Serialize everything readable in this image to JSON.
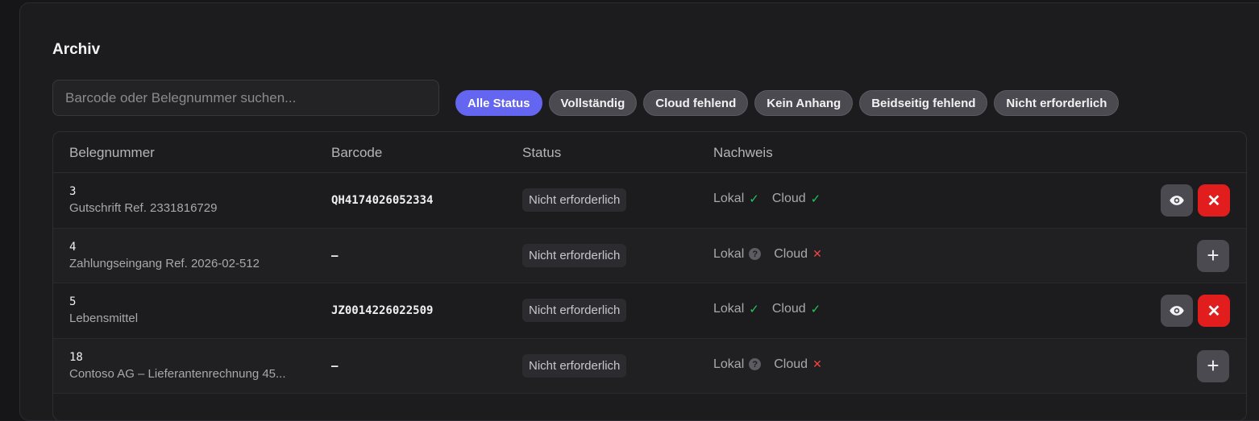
{
  "page": {
    "title": "Archiv"
  },
  "search": {
    "placeholder": "Barcode oder Belegnummer suchen..."
  },
  "filters": [
    "Alle Status",
    "Vollständig",
    "Cloud fehlend",
    "Kein Anhang",
    "Beidseitig fehlend",
    "Nicht erforderlich"
  ],
  "table": {
    "headers": {
      "number": "Belegnummer",
      "barcode": "Barcode",
      "status": "Status",
      "proof": "Nachweis"
    },
    "proof_labels": {
      "local": "Lokal",
      "cloud": "Cloud"
    },
    "rows": [
      {
        "number": "3",
        "subtitle": "Gutschrift Ref. 2331816729",
        "barcode": "QH4174026052334",
        "status": "Nicht erforderlich",
        "local": "✓",
        "local_state": "ok",
        "cloud": "✓",
        "cloud_state": "ok",
        "actions": "view-delete"
      },
      {
        "number": "4",
        "subtitle": "Zahlungseingang Ref. 2026-02-512",
        "barcode": "–",
        "status": "Nicht erforderlich",
        "local": "?",
        "local_state": "unknown",
        "cloud": "✕",
        "cloud_state": "missing",
        "actions": "add"
      },
      {
        "number": "5",
        "subtitle": "Lebensmittel",
        "barcode": "JZ0014226022509",
        "status": "Nicht erforderlich",
        "local": "✓",
        "local_state": "ok",
        "cloud": "✓",
        "cloud_state": "ok",
        "actions": "view-delete"
      },
      {
        "number": "18",
        "subtitle": "Contoso AG – Lieferantenrechnung 45...",
        "barcode": "–",
        "status": "Nicht erforderlich",
        "local": "?",
        "local_state": "unknown",
        "cloud": "✕",
        "cloud_state": "missing",
        "actions": "add"
      }
    ]
  },
  "colors": {
    "accent": "#6466f1",
    "success": "#22c55e",
    "danger": "#e11d1d"
  },
  "icons": {
    "view": "eye-icon",
    "delete": "close-icon",
    "add": "plus-icon",
    "ok": "check-icon",
    "missing": "x-icon",
    "unknown": "question-icon"
  }
}
